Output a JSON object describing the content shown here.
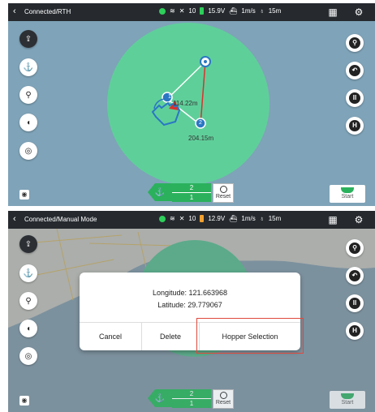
{
  "panel1": {
    "header": {
      "back_icon": "chevron-left-icon",
      "mode": "Connected/RTH",
      "signal": "10",
      "voltage": "15.9V",
      "speed": "1m/s",
      "depth": "15m",
      "battery_color": "#2ecf5a"
    },
    "map": {
      "distance_a": "114.22m",
      "distance_b": "204.15m",
      "point_1": "1",
      "point_2": "2"
    },
    "nav": {
      "top": "2",
      "bottom": "1",
      "reset": "Reset"
    },
    "start": "Start"
  },
  "panel2": {
    "header": {
      "back_icon": "chevron-left-icon",
      "mode": "Connected/Manual Mode",
      "signal": "10",
      "voltage": "12.9V",
      "speed": "1m/s",
      "depth": "15m",
      "battery_color": "#f0a030"
    },
    "dialog": {
      "longitude": "Longitude: 121.663968",
      "latitude": "Latitude: 29.779067",
      "cancel": "Cancel",
      "delete": "Delete",
      "hopper": "Hopper Selection"
    },
    "nav": {
      "top": "2",
      "bottom": "1",
      "reset": "Reset"
    },
    "start": "Start"
  },
  "colors": {
    "accent_green": "#2bb15c",
    "zone_green": "#5fcf9a",
    "highlight_red": "#e0483b",
    "topbar": "#262a2f"
  }
}
